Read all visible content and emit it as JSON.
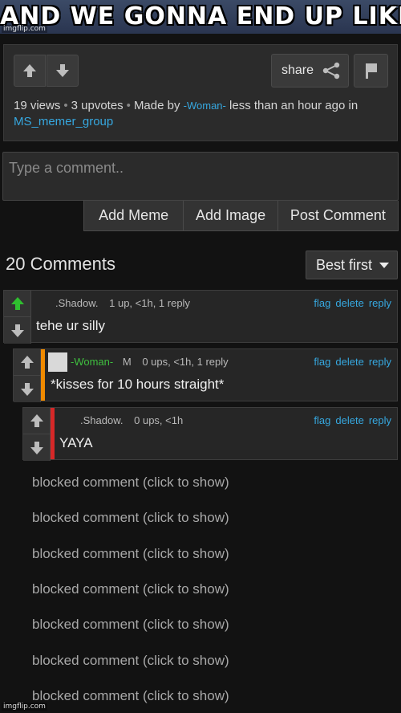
{
  "meme": {
    "caption": "AND WE GONNA END UP LIKE THIS",
    "watermark": "imgflip.com"
  },
  "post": {
    "share_label": "share",
    "views": "19 views",
    "upvotes": "3 upvotes",
    "made_by_prefix": "Made by",
    "author": "-Woman-",
    "time": "less than an hour ago in",
    "group": "MS_memer_group"
  },
  "composer": {
    "placeholder": "Type a comment..",
    "buttons": [
      "Add Meme",
      "Add Image",
      "Post Comment"
    ]
  },
  "comments_header": {
    "count": "20 Comments",
    "sort": "Best first"
  },
  "comments": [
    {
      "username": ".Shadow.",
      "stats": "1 up, <1h, 1 reply",
      "text": "tehe ur silly",
      "upvoted": true,
      "bar_color": ""
    },
    {
      "username": "-Woman-",
      "badge": "M",
      "stats": "0 ups, <1h, 1 reply",
      "text": "*kisses for 10 hours straight*",
      "bar_color": "#f08a00"
    },
    {
      "username": ".Shadow.",
      "stats": "0 ups, <1h",
      "text": "YAYA",
      "bar_color": "#d62828"
    }
  ],
  "comment_actions": {
    "flag": "flag",
    "delete": "delete",
    "reply": "reply"
  },
  "blocked_comments": [
    "blocked comment (click to show)",
    "blocked comment (click to show)",
    "blocked comment (click to show)",
    "blocked comment (click to show)",
    "blocked comment (click to show)",
    "blocked comment (click to show)",
    "blocked comment (click to show)"
  ],
  "icons": {
    "upvote": "up-arrow-icon",
    "downvote": "down-arrow-icon",
    "share": "share-icon",
    "flag": "flag-icon",
    "sort": "caret-down-icon"
  },
  "colors": {
    "link": "#36a8e0",
    "upvote_active": "#2fbf2f",
    "author_green": "#3fbf3f",
    "bar_orange": "#f08a00",
    "bar_red": "#d62828"
  }
}
